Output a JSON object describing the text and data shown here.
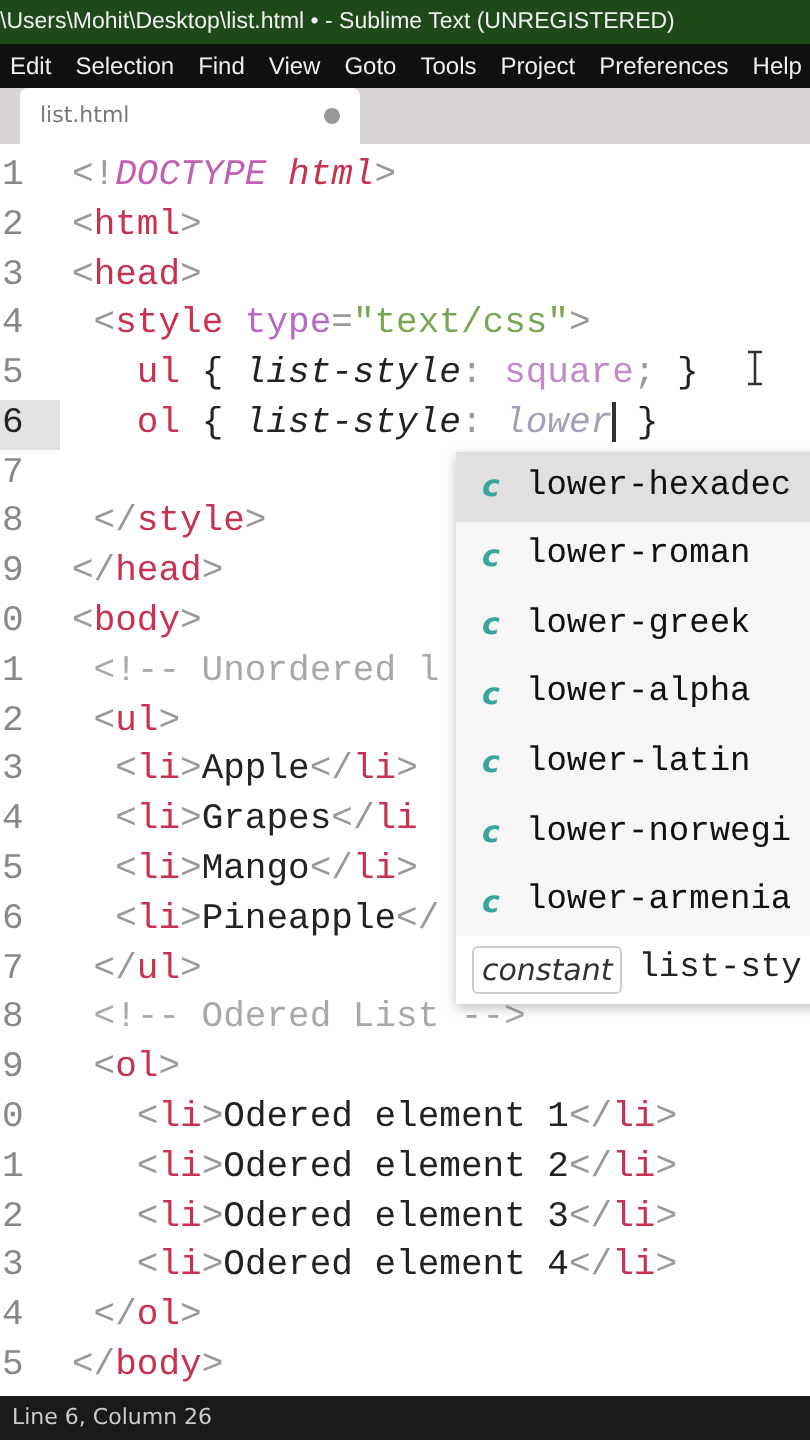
{
  "window": {
    "title": "\\Users\\Mohit\\Desktop\\list.html • - Sublime Text (UNREGISTERED)"
  },
  "menu": [
    "Edit",
    "Selection",
    "Find",
    "View",
    "Goto",
    "Tools",
    "Project",
    "Preferences",
    "Help"
  ],
  "tabs": [
    {
      "label": "list.html",
      "selected": true,
      "modified": true
    }
  ],
  "editor": {
    "lines": [
      {
        "number": "1",
        "current": false,
        "tokens": [
          {
            "kind": "punct",
            "t": "<!"
          },
          {
            "kind": "doctype",
            "t": "DOCTYPE "
          },
          {
            "kind": "tagi",
            "t": "html"
          },
          {
            "kind": "punct",
            "t": ">"
          }
        ]
      },
      {
        "number": "2",
        "current": false,
        "tokens": [
          {
            "kind": "punct",
            "t": "<"
          },
          {
            "kind": "tag",
            "t": "html"
          },
          {
            "kind": "punct",
            "t": ">"
          }
        ]
      },
      {
        "number": "3",
        "current": false,
        "tokens": [
          {
            "kind": "punct",
            "t": "<"
          },
          {
            "kind": "tag",
            "t": "head"
          },
          {
            "kind": "punct",
            "t": ">"
          }
        ]
      },
      {
        "number": "4",
        "current": false,
        "tokens": [
          {
            "kind": "punct",
            "t": " <"
          },
          {
            "kind": "tag",
            "t": "style"
          },
          {
            "kind": "attr",
            "t": " type"
          },
          {
            "kind": "punct",
            "t": "="
          },
          {
            "kind": "string",
            "t": "\"text/css\""
          },
          {
            "kind": "punct",
            "t": ">"
          }
        ]
      },
      {
        "number": "5",
        "current": false,
        "tokens": [
          {
            "kind": "tag",
            "t": "   ul"
          },
          {
            "kind": "text",
            "t": " { "
          },
          {
            "kind": "prop",
            "t": "list-style"
          },
          {
            "kind": "punct",
            "t": ": "
          },
          {
            "kind": "value",
            "t": "square"
          },
          {
            "kind": "punct",
            "t": ";"
          },
          {
            "kind": "text",
            "t": " }"
          }
        ]
      },
      {
        "number": "6",
        "current": true,
        "tokens": [
          {
            "kind": "tag",
            "t": "   ol"
          },
          {
            "kind": "text",
            "t": " { "
          },
          {
            "kind": "prop",
            "t": "list-style"
          },
          {
            "kind": "punct",
            "t": ": "
          },
          {
            "kind": "typing",
            "t": "lower",
            "caret": true
          },
          {
            "kind": "text",
            "t": " }"
          }
        ]
      },
      {
        "number": "7",
        "current": false
      },
      {
        "number": "8",
        "current": false,
        "tokens": [
          {
            "kind": "punct",
            "t": " </"
          },
          {
            "kind": "tag",
            "t": "style"
          },
          {
            "kind": "punct",
            "t": ">"
          }
        ]
      },
      {
        "number": "9",
        "current": false,
        "tokens": [
          {
            "kind": "punct",
            "t": "</"
          },
          {
            "kind": "tag",
            "t": "head"
          },
          {
            "kind": "punct",
            "t": ">"
          }
        ]
      },
      {
        "number": "0",
        "current": false,
        "tokens": [
          {
            "kind": "punct",
            "t": "<"
          },
          {
            "kind": "tag",
            "t": "body"
          },
          {
            "kind": "punct",
            "t": ">"
          }
        ]
      },
      {
        "number": "1",
        "current": false,
        "tokens": [
          {
            "kind": "comment",
            "t": " <!-- Unordered l"
          }
        ]
      },
      {
        "number": "2",
        "current": false,
        "tokens": [
          {
            "kind": "punct",
            "t": " <"
          },
          {
            "kind": "tag",
            "t": "ul"
          },
          {
            "kind": "punct",
            "t": ">"
          }
        ]
      },
      {
        "number": "3",
        "current": false,
        "tokens": [
          {
            "kind": "punct",
            "t": "  <"
          },
          {
            "kind": "tag",
            "t": "li"
          },
          {
            "kind": "punct",
            "t": ">"
          },
          {
            "kind": "text",
            "t": "Apple"
          },
          {
            "kind": "punct",
            "t": "</"
          },
          {
            "kind": "tag",
            "t": "li"
          },
          {
            "kind": "punct",
            "t": ">"
          }
        ]
      },
      {
        "number": "4",
        "current": false,
        "tokens": [
          {
            "kind": "punct",
            "t": "  <"
          },
          {
            "kind": "tag",
            "t": "li"
          },
          {
            "kind": "punct",
            "t": ">"
          },
          {
            "kind": "text",
            "t": "Grapes"
          },
          {
            "kind": "punct",
            "t": "</"
          },
          {
            "kind": "tag",
            "t": "li"
          }
        ]
      },
      {
        "number": "5",
        "current": false,
        "tokens": [
          {
            "kind": "punct",
            "t": "  <"
          },
          {
            "kind": "tag",
            "t": "li"
          },
          {
            "kind": "punct",
            "t": ">"
          },
          {
            "kind": "text",
            "t": "Mango"
          },
          {
            "kind": "punct",
            "t": "</"
          },
          {
            "kind": "tag",
            "t": "li"
          },
          {
            "kind": "punct",
            "t": ">"
          }
        ]
      },
      {
        "number": "6",
        "current": false,
        "tokens": [
          {
            "kind": "punct",
            "t": "  <"
          },
          {
            "kind": "tag",
            "t": "li"
          },
          {
            "kind": "punct",
            "t": ">"
          },
          {
            "kind": "text",
            "t": "Pineapple"
          },
          {
            "kind": "punct",
            "t": "</"
          }
        ]
      },
      {
        "number": "7",
        "current": false,
        "tokens": [
          {
            "kind": "punct",
            "t": " </"
          },
          {
            "kind": "tag",
            "t": "ul"
          },
          {
            "kind": "punct",
            "t": ">"
          }
        ]
      },
      {
        "number": "8",
        "current": false,
        "tokens": [
          {
            "kind": "comment",
            "t": " <!-- Odered List -->"
          }
        ]
      },
      {
        "number": "9",
        "current": false,
        "tokens": [
          {
            "kind": "punct",
            "t": " <"
          },
          {
            "kind": "tag",
            "t": "ol"
          },
          {
            "kind": "punct",
            "t": ">"
          }
        ]
      },
      {
        "number": "0",
        "current": false,
        "tokens": [
          {
            "kind": "punct",
            "t": "   <"
          },
          {
            "kind": "tag",
            "t": "li"
          },
          {
            "kind": "punct",
            "t": ">"
          },
          {
            "kind": "text",
            "t": "Odered element 1"
          },
          {
            "kind": "punct",
            "t": "</"
          },
          {
            "kind": "tag",
            "t": "li"
          },
          {
            "kind": "punct",
            "t": ">"
          }
        ]
      },
      {
        "number": "1",
        "current": false,
        "tokens": [
          {
            "kind": "punct",
            "t": "   <"
          },
          {
            "kind": "tag",
            "t": "li"
          },
          {
            "kind": "punct",
            "t": ">"
          },
          {
            "kind": "text",
            "t": "Odered element 2"
          },
          {
            "kind": "punct",
            "t": "</"
          },
          {
            "kind": "tag",
            "t": "li"
          },
          {
            "kind": "punct",
            "t": ">"
          }
        ]
      },
      {
        "number": "2",
        "current": false,
        "tokens": [
          {
            "kind": "punct",
            "t": "   <"
          },
          {
            "kind": "tag",
            "t": "li"
          },
          {
            "kind": "punct",
            "t": ">"
          },
          {
            "kind": "text",
            "t": "Odered element 3"
          },
          {
            "kind": "punct",
            "t": "</"
          },
          {
            "kind": "tag",
            "t": "li"
          },
          {
            "kind": "punct",
            "t": ">"
          }
        ]
      },
      {
        "number": "3",
        "current": false,
        "tokens": [
          {
            "kind": "punct",
            "t": "   <"
          },
          {
            "kind": "tag",
            "t": "li"
          },
          {
            "kind": "punct",
            "t": ">"
          },
          {
            "kind": "text",
            "t": "Odered element 4"
          },
          {
            "kind": "punct",
            "t": "</"
          },
          {
            "kind": "tag",
            "t": "li"
          },
          {
            "kind": "punct",
            "t": ">"
          }
        ]
      },
      {
        "number": "4",
        "current": false,
        "tokens": [
          {
            "kind": "punct",
            "t": " </"
          },
          {
            "kind": "tag",
            "t": "ol"
          },
          {
            "kind": "punct",
            "t": ">"
          }
        ]
      },
      {
        "number": "5",
        "current": false,
        "tokens": [
          {
            "kind": "punct",
            "t": "</"
          },
          {
            "kind": "tag",
            "t": "body"
          },
          {
            "kind": "punct",
            "t": ">"
          }
        ]
      }
    ]
  },
  "autocomplete": {
    "items": [
      {
        "kind_letter": "c",
        "label": "lower-hexadec",
        "selected": true
      },
      {
        "kind_letter": "c",
        "label": "lower-roman",
        "selected": false
      },
      {
        "kind_letter": "c",
        "label": "lower-greek",
        "selected": false
      },
      {
        "kind_letter": "c",
        "label": "lower-alpha",
        "selected": false
      },
      {
        "kind_letter": "c",
        "label": "lower-latin",
        "selected": false
      },
      {
        "kind_letter": "c",
        "label": "lower-norwegi",
        "selected": false
      },
      {
        "kind_letter": "c",
        "label": "lower-armenia",
        "selected": false
      }
    ],
    "footer_kind": "constant",
    "footer_text": "list-sty"
  },
  "status_bar": "Line 6, Column 26"
}
